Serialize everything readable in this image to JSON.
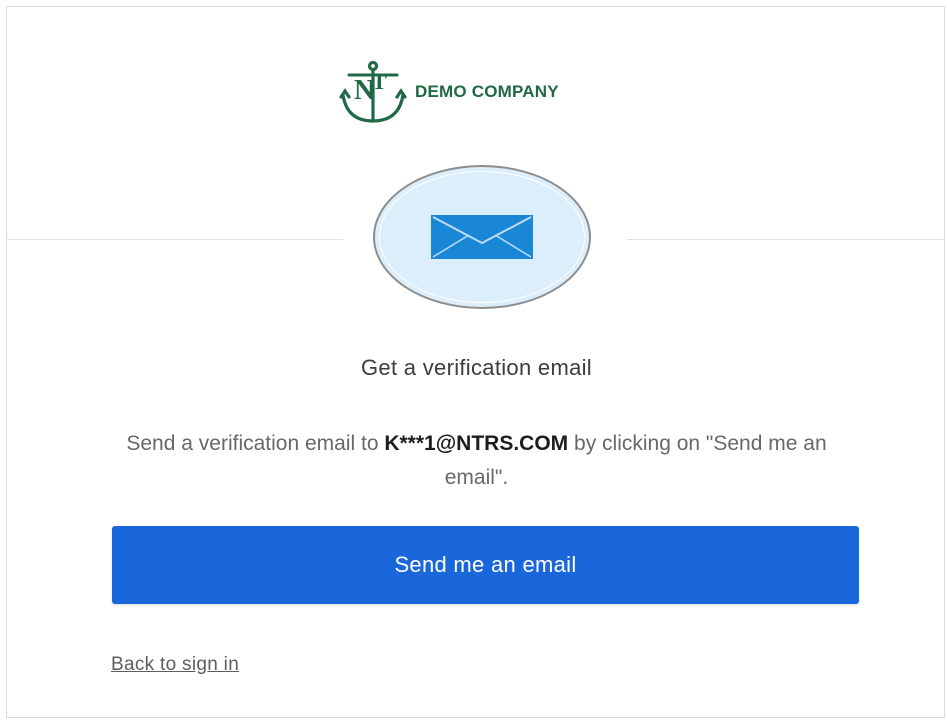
{
  "brand": {
    "logo_icon": "anchor-nt-logo-icon",
    "name": "DEMO COMPANY",
    "color": "#1f6a45"
  },
  "factor": {
    "icon": "email-envelope-icon",
    "icon_color": "#1a87d6",
    "circle_fill": "#dcedfb"
  },
  "content": {
    "title": "Get a verification email",
    "desc_prefix": "Send a verification email to ",
    "masked_email": "K***1@NTRS.COM",
    "desc_suffix": " by clicking on \"Send me an email\"."
  },
  "actions": {
    "send_label": "Send me an email",
    "send_color": "#1a67db",
    "back_label": "Back to sign in"
  }
}
